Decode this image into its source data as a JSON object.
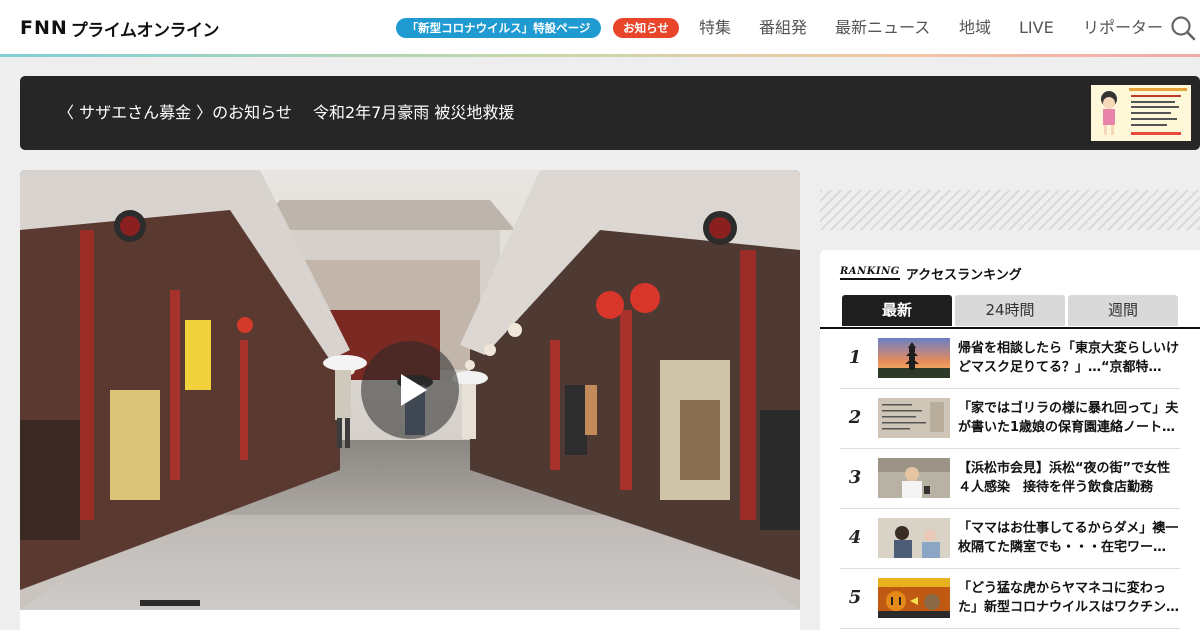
{
  "header": {
    "logo_mark": "FNN",
    "logo_text": "プライムオンライン",
    "corona_pill": "「新型コロナウイルス」特設ページ",
    "notice_pill": "お知らせ",
    "nav": [
      "特集",
      "番組発",
      "最新ニュース",
      "地域",
      "LIVE",
      "リポーター"
    ],
    "search_icon": "search-icon"
  },
  "banner": {
    "text": "〈 サザエさん募金 〉のお知らせ　 令和2年7月豪雨 被災地救援",
    "thumb_icon": "sazae-fund-flyer"
  },
  "hero": {
    "image": "asakusa-nakamise-street-in-rain",
    "play_icon": "play-icon"
  },
  "ranking": {
    "logo": "RANKING",
    "title": "アクセスランキング",
    "tabs": [
      {
        "label": "最新",
        "active": true
      },
      {
        "label": "24時間",
        "active": false
      },
      {
        "label": "週間",
        "active": false
      }
    ],
    "items": [
      {
        "rank": "1",
        "text": "帰省を相談したら「東京大変らしいけどマスク足りてる？」…“京都特…",
        "thumb": "kyoto-pagoda-sunset"
      },
      {
        "rank": "2",
        "text": "「家ではゴリラの様に暴れ回って」夫が書いた1歳娘の保育園連絡ノート…",
        "thumb": "handwritten-notebook"
      },
      {
        "rank": "3",
        "text": "【浜松市会見】浜松“夜の街”で女性４人感染　接待を伴う飲食店勤務",
        "thumb": "press-conference"
      },
      {
        "rank": "4",
        "text": "「ママはお仕事してるからダメ」襖一枚隔てた隣室でも・・・在宅ワー…",
        "thumb": "mother-remote-work"
      },
      {
        "rank": "5",
        "text": "「どう猛な虎からヤマネコに変わった」新型コロナウイルスはワクチン…",
        "thumb": "tiger-to-wildcat-graphic"
      }
    ]
  },
  "colors": {
    "corona_pill": "#1f9bd2",
    "notice_pill": "#e8452a",
    "banner_bg": "#262626",
    "tab_active": "#1e1e1e"
  }
}
